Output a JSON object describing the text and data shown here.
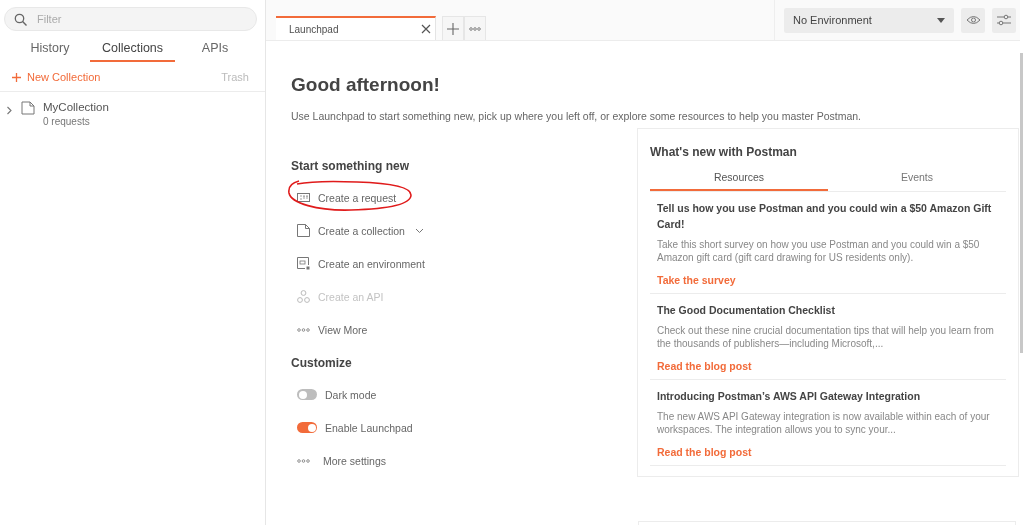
{
  "sidebar": {
    "search": {
      "placeholder": "Filter"
    },
    "tabs": [
      {
        "label": "History",
        "selected": false
      },
      {
        "label": "Collections",
        "selected": true
      },
      {
        "label": "APIs",
        "selected": false
      }
    ],
    "new_collection": "New Collection",
    "trash": "Trash",
    "collections": [
      {
        "name": "MyCollection",
        "count": "0 requests",
        "expanded": false
      }
    ]
  },
  "tabs": [
    {
      "label": "Launchpad",
      "selected": true
    }
  ],
  "environment": {
    "value": "No Environment"
  },
  "launchpad": {
    "greeting": "Good afternoon!",
    "intro": "Use Launchpad to start something new, pick up where you left off, or explore some resources to help you master Postman.",
    "start_title": "Start something new",
    "start_items": [
      {
        "kind": "request",
        "label": "Create a request",
        "disabled": false,
        "circled": true,
        "dropdown": false
      },
      {
        "kind": "collection",
        "label": "Create a collection",
        "disabled": false,
        "dropdown": true
      },
      {
        "kind": "environment",
        "label": "Create an environment",
        "disabled": false
      },
      {
        "kind": "api",
        "label": "Create an API",
        "disabled": true
      },
      {
        "kind": "more",
        "label": "View More",
        "disabled": false
      }
    ],
    "customize_title": "Customize",
    "customize_items": [
      {
        "kind": "toggle",
        "label": "Dark mode",
        "on": false
      },
      {
        "kind": "toggle",
        "label": "Enable Launchpad",
        "on": true
      },
      {
        "kind": "more",
        "label": "More settings"
      }
    ]
  },
  "whats_new": {
    "title": "What's new with Postman",
    "tabs": [
      {
        "label": "Resources",
        "selected": true
      },
      {
        "label": "Events",
        "selected": false
      }
    ],
    "articles": [
      {
        "title": "Tell us how you use Postman and you could win a $50 Amazon Gift Card!",
        "body": "Take this short survey on how you use Postman and you could win a $50 Amazon gift card (gift card drawing for US residents only).",
        "link": "Take the survey"
      },
      {
        "title": "The Good Documentation Checklist",
        "body": "Check out these nine crucial documentation tips that will help you learn from the thousands of publishers—including Microsoft,...",
        "link": "Read the blog post"
      },
      {
        "title": "Introducing Postman’s AWS API Gateway Integration",
        "body": "The new AWS API Gateway integration is now available within each of your workspaces. The integration allows you to sync your...",
        "link": "Read the blog post"
      }
    ]
  }
}
